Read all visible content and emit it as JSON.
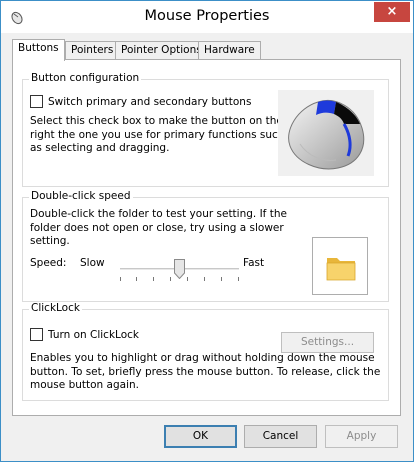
{
  "window": {
    "title": "Mouse Properties",
    "close_label": "×",
    "app_icon": "mouse-icon"
  },
  "tabs": [
    {
      "label": "Buttons",
      "active": true
    },
    {
      "label": "Pointers"
    },
    {
      "label": "Pointer Options"
    },
    {
      "label": "Hardware"
    }
  ],
  "button_config": {
    "title": "Button configuration",
    "checkbox_label": "Switch primary and secondary buttons",
    "checked": false,
    "description_lines": [
      "Select this check box to make the button on the",
      "right the one you use for primary functions such",
      "as selecting and dragging."
    ]
  },
  "double_click": {
    "title": "Double-click speed",
    "description_lines": [
      "Double-click the folder to test your setting. If the",
      "folder does not open or close, try using a slower",
      "setting."
    ],
    "speed_label": "Speed:",
    "slow_label": "Slow",
    "fast_label": "Fast",
    "slider_value_fraction": 0.5
  },
  "clicklock": {
    "title": "ClickLock",
    "checkbox_label": "Turn on ClickLock",
    "checked": false,
    "settings_label": "Settings...",
    "description_lines": [
      "Enables you to highlight or drag without holding down the mouse",
      "button. To set, briefly press the mouse button. To release, click the",
      "mouse button again."
    ]
  },
  "buttons": {
    "ok": "OK",
    "cancel": "Cancel",
    "apply": "Apply"
  },
  "colors": {
    "window_border": "#3c8fc7",
    "close_button": "#c7463f",
    "mouse_highlight": "#1e3adb",
    "folder": "#f2c94c"
  }
}
